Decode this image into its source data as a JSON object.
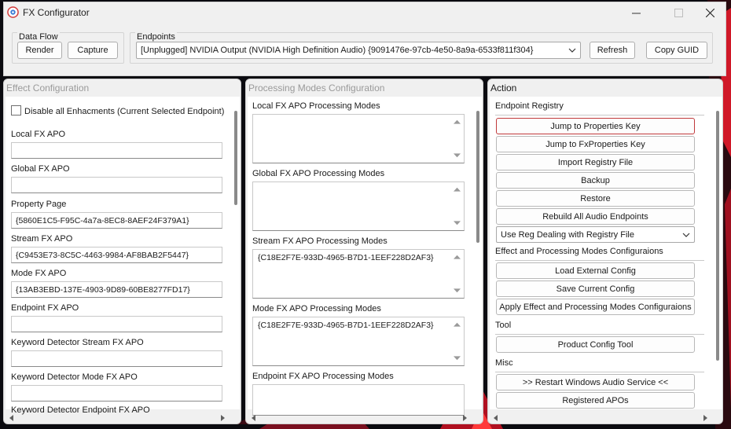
{
  "window": {
    "title": "FX Configurator"
  },
  "data_flow": {
    "label": "Data Flow",
    "render_label": "Render",
    "capture_label": "Capture"
  },
  "endpoints": {
    "label": "Endpoints",
    "selected": "[Unplugged] NVIDIA Output (NVIDIA High Definition Audio) {9091476e-97cb-4e50-8a9a-6533f811f304}",
    "refresh_label": "Refresh",
    "copy_guid_label": "Copy GUID"
  },
  "effect_config": {
    "title": "Effect Configuration",
    "disable_all_label": "Disable all Enhacments (Current Selected Endpoint)",
    "fields": [
      {
        "label": "Local FX APO",
        "value": ""
      },
      {
        "label": "Global FX APO",
        "value": ""
      },
      {
        "label": "Property Page",
        "value": "{5860E1C5-F95C-4a7a-8EC8-8AEF24F379A1}"
      },
      {
        "label": "Stream FX APO",
        "value": "{C9453E73-8C5C-4463-9984-AF8BAB2F5447}"
      },
      {
        "label": "Mode FX APO",
        "value": "{13AB3EBD-137E-4903-9D89-60BE8277FD17}"
      },
      {
        "label": "Endpoint FX APO",
        "value": ""
      },
      {
        "label": "Keyword Detector Stream FX APO",
        "value": ""
      },
      {
        "label": "Keyword Detector Mode FX APO",
        "value": ""
      },
      {
        "label": "Keyword Detector Endpoint FX APO",
        "value": ""
      }
    ]
  },
  "processing_modes": {
    "title": "Processing Modes Configuration",
    "sections": [
      {
        "label": "Local FX APO Processing Modes",
        "value": ""
      },
      {
        "label": "Global FX APO Processing Modes",
        "value": ""
      },
      {
        "label": "Stream FX APO Processing Modes",
        "value": "{C18E2F7E-933D-4965-B7D1-1EEF228D2AF3}"
      },
      {
        "label": "Mode FX APO Processing Modes",
        "value": "{C18E2F7E-933D-4965-B7D1-1EEF228D2AF3}"
      },
      {
        "label": "Endpoint FX APO Processing Modes",
        "value": ""
      }
    ]
  },
  "action": {
    "title": "Action",
    "endpoint_registry_label": "Endpoint Registry",
    "jump_props": "Jump to Properties Key",
    "jump_fx": "Jump to FxProperties Key",
    "import_reg": "Import Registry File",
    "backup": "Backup",
    "restore": "Restore",
    "rebuild": "Rebuild All Audio Endpoints",
    "reg_dealing": "Use Reg Dealing with Registry File",
    "effect_modes_label": "Effect and Processing Modes Configuraions",
    "load_ext": "Load External Config",
    "save_cur": "Save Current Config",
    "apply_cfg": "Apply Effect and Processing Modes Configuraions",
    "tool_label": "Tool",
    "product_tool": "Product Config Tool",
    "misc_label": "Misc",
    "restart_audio": ">> Restart Windows Audio Service <<",
    "registered_apos": "Registered APOs"
  },
  "colors": {
    "window_bg": "#f0f0f0",
    "focus_border": "#c0393b",
    "desktop_bg": "#0b0b10"
  }
}
